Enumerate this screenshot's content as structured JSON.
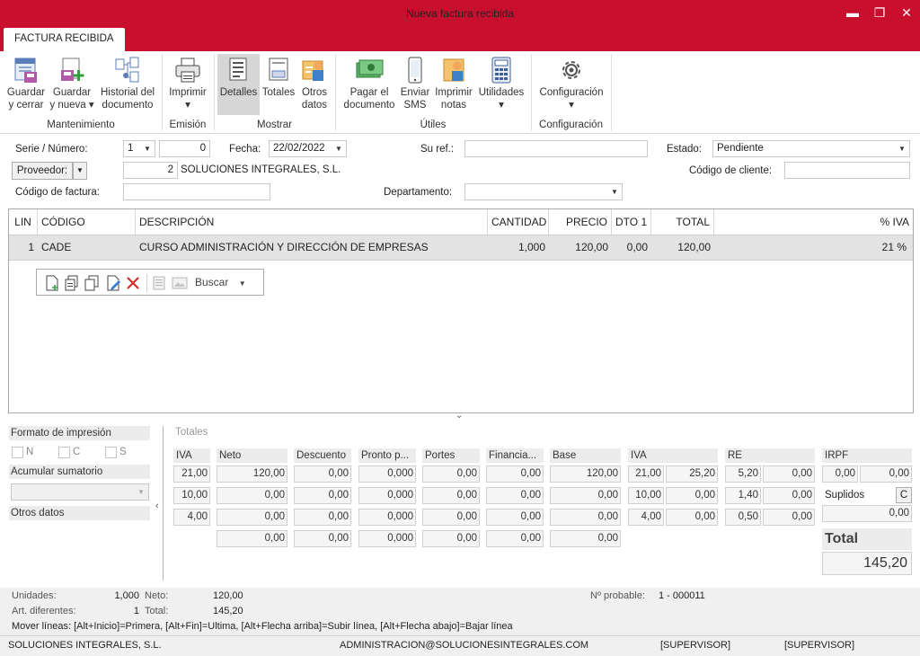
{
  "window": {
    "title": "Nueva factura recibida",
    "minimize": "▬",
    "restore": "❐",
    "close": "✕"
  },
  "tabs": [
    "FACTURA RECIBIDA"
  ],
  "ribbon": {
    "guardar_cerrar": [
      "Guardar",
      "y cerrar"
    ],
    "guardar_nueva": [
      "Guardar",
      "y nueva ▾"
    ],
    "historial": [
      "Historial del",
      "documento"
    ],
    "imprimir": [
      "Imprimir",
      "▾"
    ],
    "detalles": "Detalles",
    "totales": "Totales",
    "otros": [
      "Otros",
      "datos"
    ],
    "pagar": [
      "Pagar el",
      "documento"
    ],
    "sms": [
      "Enviar",
      "SMS"
    ],
    "notas": [
      "Imprimir",
      "notas"
    ],
    "utilidades": [
      "Utilidades",
      "▾"
    ],
    "configuracion": [
      "Configuración",
      "▾"
    ],
    "groups": [
      "Mantenimiento",
      "Emisión",
      "Mostrar",
      "Útiles",
      "Configuración"
    ]
  },
  "form": {
    "serie_label": "Serie / Número:",
    "serie": "1",
    "numero": "0",
    "fecha_label": "Fecha:",
    "fecha": "22/02/2022",
    "suref_label": "Su ref.:",
    "suref": "",
    "estado_label": "Estado:",
    "estado": "Pendiente",
    "proveedor_btn": "Proveedor:",
    "proveedor_num": "2",
    "proveedor_name": "SOLUCIONES INTEGRALES, S.L.",
    "cliente_label": "Código de cliente:",
    "cliente": "",
    "factura_label": "Código de factura:",
    "factura": "",
    "depto_label": "Departamento:",
    "depto": ""
  },
  "grid": {
    "headers": [
      "LIN",
      "CÓDIGO",
      "DESCRIPCIÓN",
      "CANTIDAD",
      "PRECIO",
      "DTO 1",
      "TOTAL",
      "% IVA"
    ],
    "rows": [
      [
        "1",
        "CADE",
        "CURSO ADMINISTRACIÓN Y DIRECCIÓN DE EMPRESAS",
        "1,000",
        "120,00",
        "0,00",
        "120,00",
        "21 %"
      ]
    ],
    "buscar": "Buscar"
  },
  "left_panel": {
    "formato": "Formato de impresión",
    "checks": [
      "N",
      "C",
      "S"
    ],
    "acumular": "Acumular sumatorio",
    "otros": "Otros datos"
  },
  "totales": {
    "title": "Totales",
    "headers": [
      "IVA",
      "Neto",
      "Descuento",
      "Pronto p...",
      "Portes",
      "Financia...",
      "Base",
      "IVA",
      "RE",
      "IRPF"
    ],
    "rows": [
      [
        "21,00",
        "120,00",
        "0,00",
        "0,000",
        "0,00",
        "0,00",
        "120,00",
        "21,00",
        "25,20",
        "5,20",
        "0,00"
      ],
      [
        "10,00",
        "0,00",
        "0,00",
        "0,000",
        "0,00",
        "0,00",
        "0,00",
        "10,00",
        "0,00",
        "1,40",
        "0,00"
      ],
      [
        "4,00",
        "0,00",
        "0,00",
        "0,000",
        "0,00",
        "0,00",
        "0,00",
        "4,00",
        "0,00",
        "0,50",
        "0,00"
      ],
      [
        "",
        "0,00",
        "0,00",
        "0,000",
        "0,00",
        "0,00",
        "0,00",
        "",
        "",
        "",
        ""
      ]
    ],
    "irpf": [
      "0,00",
      "0,00"
    ],
    "suplidos_label": "Suplidos",
    "suplidos_btn": "C",
    "suplidos": "0,00",
    "total_label": "Total",
    "total": "145,20"
  },
  "footer": {
    "unidades_label": "Unidades:",
    "unidades": "1,000",
    "neto_label": "Neto:",
    "neto": "120,00",
    "art_label": "Art. diferentes:",
    "art": "1",
    "total_label": "Total:",
    "total": "145,20",
    "nprob_label": "Nº probable:",
    "nprob": "1 - 000011",
    "hint": "Mover líneas: [Alt+Inicio]=Primera, [Alt+Fin]=Ultima, [Alt+Flecha arriba]=Subir línea, [Alt+Flecha abajo]=Bajar línea",
    "company": "SOLUCIONES INTEGRALES, S.L.",
    "email": "ADMINISTRACION@SOLUCIONESINTEGRALES.COM",
    "user1": "[SUPERVISOR]",
    "user2": "[SUPERVISOR]"
  }
}
